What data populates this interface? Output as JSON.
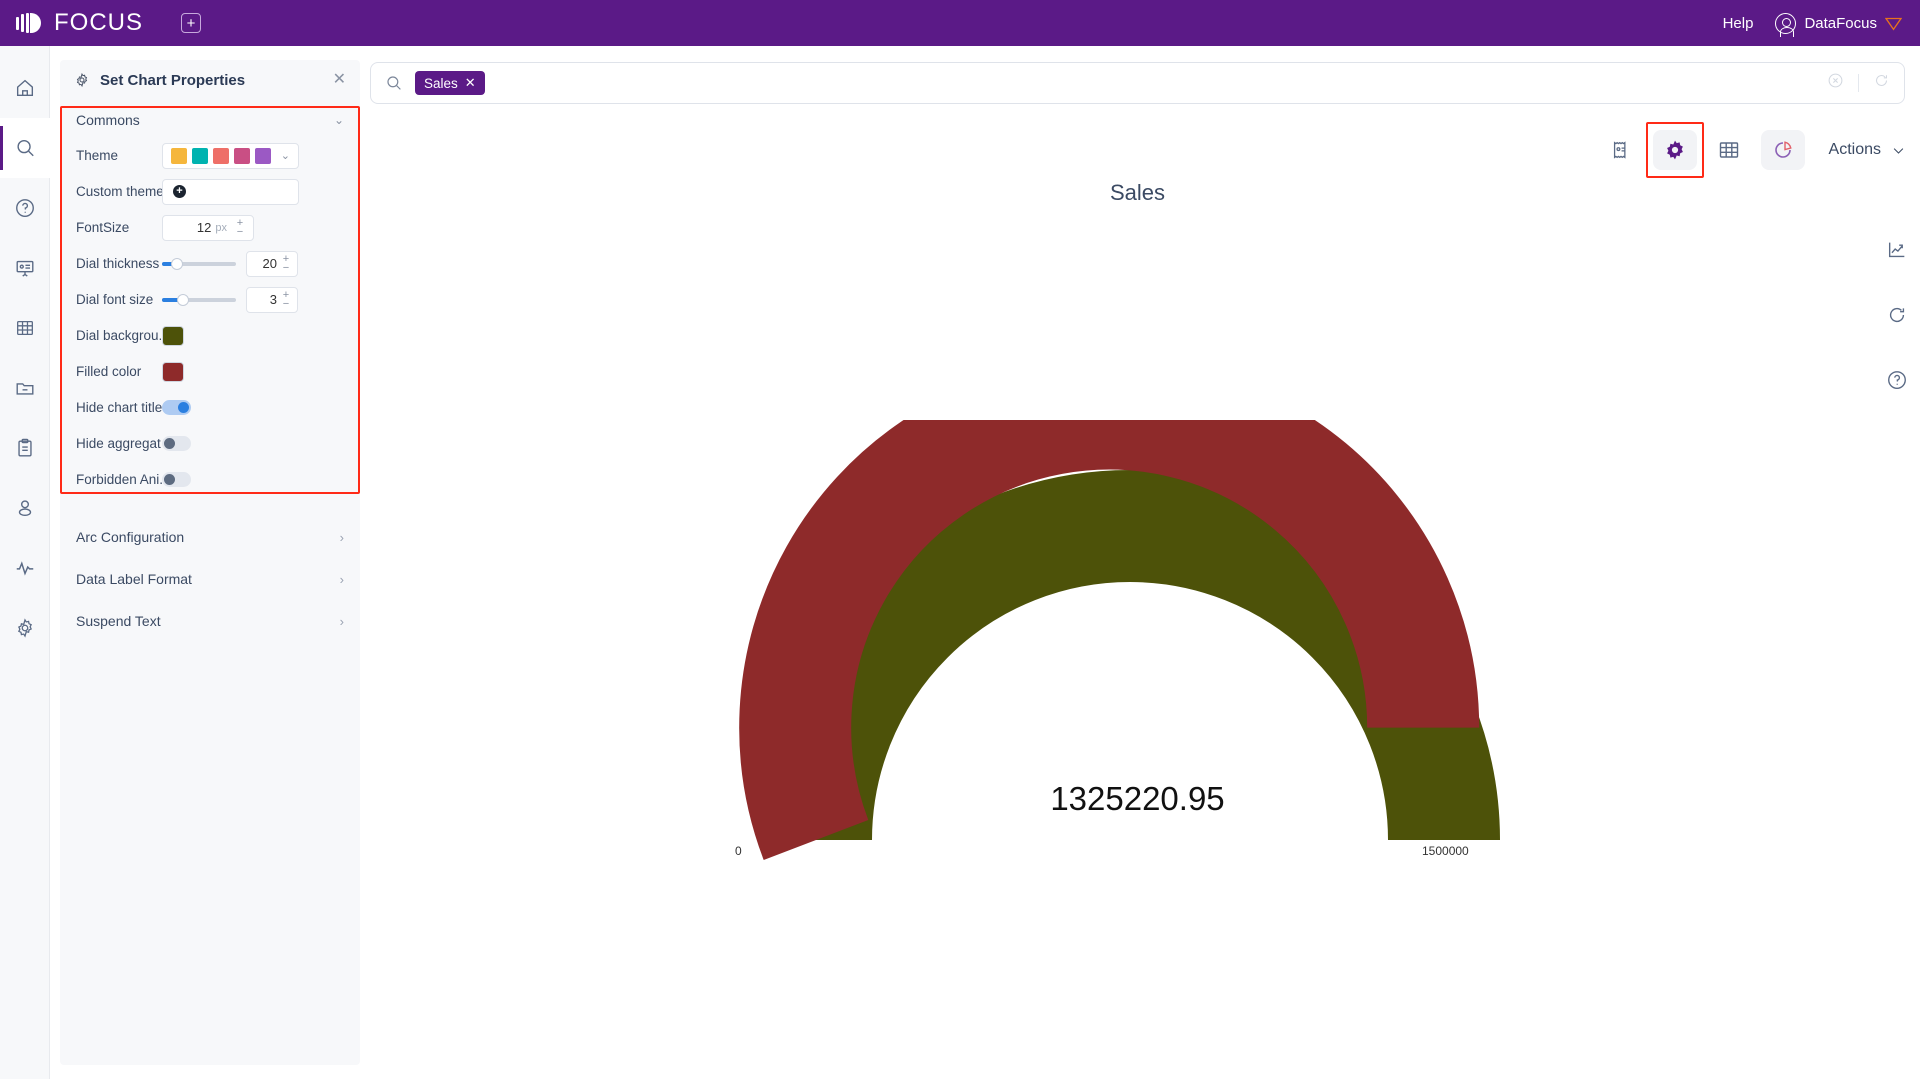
{
  "topbar": {
    "brand": "FOCUS",
    "add_tab_icon": "plus-square-icon",
    "help_label": "Help",
    "user_label": "DataFocus"
  },
  "rail": {
    "items": [
      {
        "name": "home",
        "icon": "home-icon",
        "active": false
      },
      {
        "name": "search",
        "icon": "search-icon",
        "active": true
      },
      {
        "name": "help",
        "icon": "question-circle-icon",
        "active": false
      },
      {
        "name": "presentation",
        "icon": "presentation-icon",
        "active": false
      },
      {
        "name": "table",
        "icon": "table-grid-icon",
        "active": false
      },
      {
        "name": "folder",
        "icon": "folder-minus-icon",
        "active": false
      },
      {
        "name": "clipboard",
        "icon": "clipboard-icon",
        "active": false
      },
      {
        "name": "user",
        "icon": "user-icon",
        "active": false
      },
      {
        "name": "activity",
        "icon": "pulse-icon",
        "active": false
      },
      {
        "name": "settings",
        "icon": "gear-icon",
        "active": false
      }
    ]
  },
  "panel": {
    "title": "Set Chart Properties",
    "close_icon": "close-icon",
    "gear_icon": "gear-icon",
    "section": {
      "label": "Commons",
      "expanded": true
    },
    "rows": {
      "theme": {
        "label": "Theme",
        "swatches": [
          "#f5b63c",
          "#00b3b0",
          "#ee6f68",
          "#c94f84",
          "#9b59c4"
        ]
      },
      "custom_theme": {
        "label": "Custom theme",
        "add_icon": "plus-circle-icon"
      },
      "font_size": {
        "label": "FontSize",
        "value": "12",
        "unit": "px"
      },
      "dial_thickness": {
        "label": "Dial thickness",
        "value": "20",
        "slider_pct": 18
      },
      "dial_font_size": {
        "label": "Dial font size",
        "value": "3",
        "slider_pct": 26
      },
      "dial_background": {
        "label": "Dial backgrou...",
        "color": "#4d5209"
      },
      "filled_color": {
        "label": "Filled color",
        "color": "#8e2a2a"
      },
      "hide_chart_title": {
        "label": "Hide chart title",
        "state": "on"
      },
      "hide_aggregate": {
        "label": "Hide aggregat...",
        "state": "off"
      },
      "forbidden_animation": {
        "label": "Forbidden Ani...",
        "state": "off"
      }
    },
    "sub_sections": [
      {
        "label": "Arc Configuration"
      },
      {
        "label": "Data Label Format"
      },
      {
        "label": "Suspend Text"
      }
    ]
  },
  "search": {
    "icon": "search-icon",
    "token": "Sales",
    "token_remove_icon": "close-icon",
    "clear_icon": "clear-circle-icon",
    "refresh_icon": "refresh-icon"
  },
  "chart_toolbar": {
    "buttons": [
      {
        "name": "ticket-icon",
        "label": "",
        "active": false,
        "highlighted": false
      },
      {
        "name": "gear-icon",
        "label": "",
        "active": true,
        "highlighted": true
      },
      {
        "name": "table-grid-icon",
        "label": "",
        "active": false,
        "highlighted": false
      },
      {
        "name": "pie-chart-icon",
        "label": "",
        "active": true,
        "highlighted": false
      }
    ],
    "actions_label": "Actions",
    "actions_chevron": "chevron-down-icon"
  },
  "edge_tools": [
    {
      "name": "trend-chart-icon"
    },
    {
      "name": "refresh-icon"
    },
    {
      "name": "question-circle-icon"
    }
  ],
  "chart_data": {
    "type": "gauge",
    "title": "Sales",
    "value": 1325220.95,
    "value_label": "1325220.95",
    "min": 0,
    "max": 1500000,
    "min_label": "0",
    "max_label": "1500000",
    "filled_color": "#8e2a2a",
    "background_color": "#4d5209",
    "start_angle": 180,
    "end_angle": 0,
    "thickness": 20,
    "percent_filled": 88.3
  }
}
